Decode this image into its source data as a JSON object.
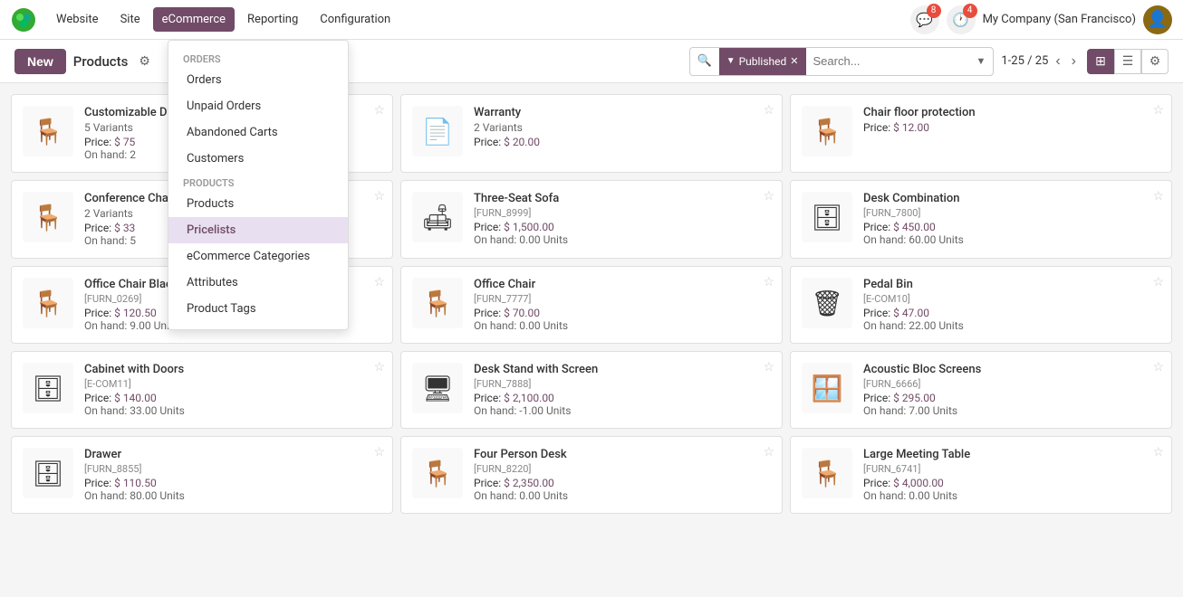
{
  "nav": {
    "website": "Website",
    "site": "Site",
    "ecommerce": "eCommerce",
    "reporting": "Reporting",
    "configuration": "Configuration",
    "company": "My Company (San Francisco)",
    "badge_messages": "8",
    "badge_activity": "4"
  },
  "toolbar": {
    "new_label": "New",
    "title": "Products",
    "pagination": "1-25 / 25",
    "filter_tag": "Published"
  },
  "search": {
    "placeholder": "Search..."
  },
  "dropdown": {
    "orders_section": "Orders",
    "items_orders": [
      {
        "label": "Orders",
        "selected": false
      },
      {
        "label": "Unpaid Orders",
        "selected": false
      },
      {
        "label": "Abandoned Carts",
        "selected": false
      },
      {
        "label": "Customers",
        "selected": false
      }
    ],
    "products_section": "Products",
    "items_products": [
      {
        "label": "Products",
        "selected": false
      },
      {
        "label": "Pricelists",
        "selected": true
      },
      {
        "label": "eCommerce Categories",
        "selected": false
      },
      {
        "label": "Attributes",
        "selected": false
      },
      {
        "label": "Product Tags",
        "selected": false
      }
    ]
  },
  "products": [
    {
      "name": "Customizable Desk",
      "variants": "5 Variants",
      "price": "$ 75",
      "stock": "2",
      "sku": "",
      "emoji": "🪑"
    },
    {
      "name": "Warranty",
      "variants": "2 Variants",
      "price": "$ 20.00",
      "stock": "",
      "sku": "",
      "emoji": "📄"
    },
    {
      "name": "Chair floor protection",
      "variants": "",
      "price": "$ 12.00",
      "stock": "",
      "sku": "",
      "emoji": "🪑"
    },
    {
      "name": "Conference Chair",
      "variants": "2 Variants",
      "price": "$ 33",
      "stock": "5",
      "sku": "",
      "emoji": "🪑"
    },
    {
      "name": "Three-Seat Sofa",
      "variants": "",
      "price": "$ 1,500.00",
      "stock": "0.00 Units",
      "sku": "[FURN_8999]",
      "emoji": "🛋"
    },
    {
      "name": "Desk Combination",
      "variants": "",
      "price": "$ 450.00",
      "stock": "60.00 Units",
      "sku": "[FURN_7800]",
      "emoji": "🗄"
    },
    {
      "name": "Office Chair Black",
      "variants": "",
      "price": "$ 120.50",
      "stock": "9.00 Units",
      "sku": "[FURN_0269]",
      "emoji": "🪑"
    },
    {
      "name": "Office Chair",
      "variants": "",
      "price": "$ 70.00",
      "stock": "0.00 Units",
      "sku": "[FURN_7777]",
      "emoji": "🪑"
    },
    {
      "name": "Pedal Bin",
      "variants": "",
      "price": "$ 47.00",
      "stock": "22.00 Units",
      "sku": "[E-COM10]",
      "emoji": "🗑"
    },
    {
      "name": "Cabinet with Doors",
      "variants": "",
      "price": "$ 140.00",
      "stock": "33.00 Units",
      "sku": "[E-COM11]",
      "emoji": "🗄"
    },
    {
      "name": "Desk Stand with Screen",
      "variants": "",
      "price": "$ 2,100.00",
      "stock": "-1.00 Units",
      "sku": "[FURN_7888]",
      "emoji": "🖥"
    },
    {
      "name": "Acoustic Bloc Screens",
      "variants": "",
      "price": "$ 295.00",
      "stock": "7.00 Units",
      "sku": "[FURN_6666]",
      "emoji": "🪟"
    },
    {
      "name": "Drawer",
      "variants": "",
      "price": "$ 110.50",
      "stock": "80.00 Units",
      "sku": "[FURN_8855]",
      "emoji": "🗄"
    },
    {
      "name": "Four Person Desk",
      "variants": "",
      "price": "$ 2,350.00",
      "stock": "0.00 Units",
      "sku": "[FURN_8220]",
      "emoji": "🪑"
    },
    {
      "name": "Large Meeting Table",
      "variants": "",
      "price": "$ 4,000.00",
      "stock": "0.00 Units",
      "sku": "[FURN_6741]",
      "emoji": "🪑"
    }
  ]
}
